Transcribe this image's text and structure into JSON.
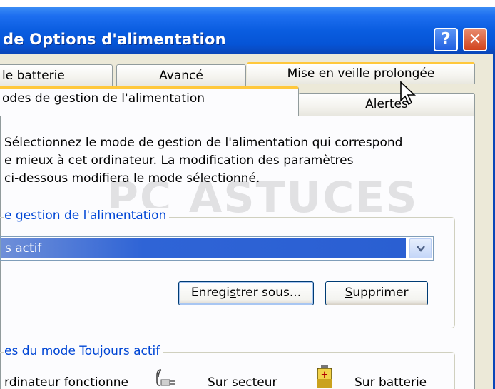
{
  "window": {
    "title": "de Options d'alimentation",
    "help_label": "?",
    "close_label": "✕"
  },
  "tabs": {
    "row1": [
      {
        "label": "le batterie"
      },
      {
        "label": "Avancé"
      },
      {
        "label": "Mise en veille prolongée"
      }
    ],
    "row2": [
      {
        "label": "odes de gestion de l'alimentation"
      },
      {
        "label": "Alertes"
      }
    ],
    "active": "odes de gestion de l'alimentation"
  },
  "description": {
    "line1": "Sélectionnez le mode de gestion de l'alimentation qui correspond",
    "line2": "e mieux à cet ordinateur. La modification des paramètres",
    "line3": "ci-dessous modifiera le mode sélectionné."
  },
  "scheme_group": {
    "legend": "e gestion de l'alimentation",
    "selected_value": "s actif",
    "save_label_pre": "Enregi",
    "save_label_ul": "s",
    "save_label_post": "trer sous...",
    "delete_label_ul": "S",
    "delete_label_post": "upprimer"
  },
  "settings_group": {
    "legend": "es du mode Toujours actif",
    "row_label": "rdinateur fonctionne",
    "ac_label": "Sur secteur",
    "battery_label": "Sur batterie"
  },
  "watermark": "PC ASTUCES",
  "colors": {
    "titlebar": "#0654d6",
    "active_tab_accent": "#ffc83c",
    "group_legend": "#0046d5",
    "selection": "#2f64d6"
  }
}
